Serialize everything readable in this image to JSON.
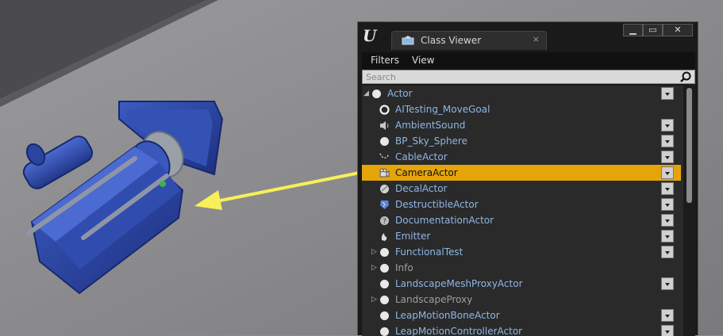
{
  "window": {
    "tab_title": "Class Viewer",
    "tab_close": "×",
    "logo": "U",
    "buttons": {
      "minimize": "▁",
      "maximize": "▭",
      "close": "✕"
    }
  },
  "menu": {
    "filters": "Filters",
    "view": "View"
  },
  "search": {
    "placeholder": "Search"
  },
  "tree": {
    "items": [
      {
        "label": "Actor",
        "icon": "white-dot-icon",
        "expander": "expanded-triangle-icon",
        "dropdown": true
      },
      {
        "label": "AITesting_MoveGoal",
        "icon": "ring-icon",
        "dropdown": false
      },
      {
        "label": "AmbientSound",
        "icon": "speaker-icon",
        "dropdown": true
      },
      {
        "label": "BP_Sky_Sphere",
        "icon": "white-dot-icon",
        "dropdown": true
      },
      {
        "label": "CableActor",
        "icon": "cable-icon",
        "dropdown": true
      },
      {
        "label": "CameraActor",
        "icon": "camera-icon",
        "dropdown": true,
        "selected": true
      },
      {
        "label": "DecalActor",
        "icon": "decal-icon",
        "dropdown": true
      },
      {
        "label": "DestructibleActor",
        "icon": "destructible-icon",
        "dropdown": true
      },
      {
        "label": "DocumentationActor",
        "icon": "question-icon",
        "dropdown": true
      },
      {
        "label": "Emitter",
        "icon": "emitter-icon",
        "dropdown": true
      },
      {
        "label": "FunctionalTest",
        "icon": "white-dot-icon",
        "expander": "collapsed-triangle-icon",
        "dropdown": true
      },
      {
        "label": "Info",
        "icon": "white-dot-icon",
        "expander": "collapsed-triangle-icon",
        "dropdown": false,
        "muted": true
      },
      {
        "label": "LandscapeMeshProxyActor",
        "icon": "white-dot-icon",
        "dropdown": true
      },
      {
        "label": "LandscapeProxy",
        "icon": "white-dot-icon",
        "expander": "collapsed-triangle-icon",
        "dropdown": false,
        "muted": true
      },
      {
        "label": "LeapMotionBoneActor",
        "icon": "white-dot-icon",
        "dropdown": true
      },
      {
        "label": "LeapMotionControllerActor",
        "icon": "white-dot-icon",
        "dropdown": true
      }
    ]
  },
  "colors": {
    "selection": "#e5a50a",
    "label": "#8fb6e4",
    "arrow": "#f7f058",
    "camera_body": "#2d4aa6"
  }
}
